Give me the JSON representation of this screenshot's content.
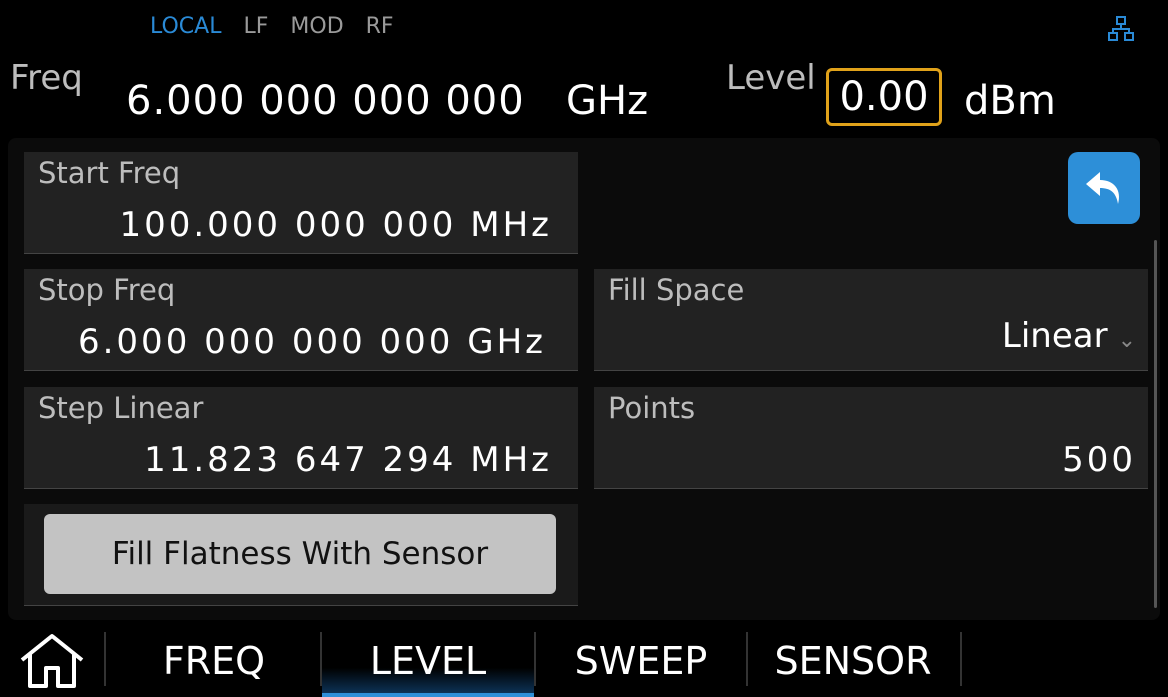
{
  "status": {
    "modes": [
      "LOCAL",
      "LF",
      "MOD",
      "RF"
    ],
    "active_mode": "LOCAL",
    "network_icon": "network-icon",
    "accent_color": "#2a8ad6"
  },
  "header": {
    "freq_label": "Freq",
    "freq_value": "6.000 000 000 000",
    "freq_unit": "GHz",
    "level_label": "Level",
    "level_value": "0.00",
    "level_unit": "dBm",
    "level_highlight_color": "#e0a21a"
  },
  "panel": {
    "start_freq": {
      "label": "Start Freq",
      "value": "100.000 000 000 MHz"
    },
    "stop_freq": {
      "label": "Stop Freq",
      "value": "6.000 000 000 000 GHz"
    },
    "step_linear": {
      "label": "Step Linear",
      "value": "11.823 647 294 MHz"
    },
    "fill_space": {
      "label": "Fill Space",
      "value": "Linear"
    },
    "points": {
      "label": "Points",
      "value": "500"
    },
    "fill_button": "Fill Flatness With Sensor",
    "back_icon": "back-arrow-icon"
  },
  "tabs": {
    "home_icon": "home-icon",
    "items": [
      "FREQ",
      "LEVEL",
      "SWEEP",
      "SENSOR"
    ],
    "active": "LEVEL"
  }
}
